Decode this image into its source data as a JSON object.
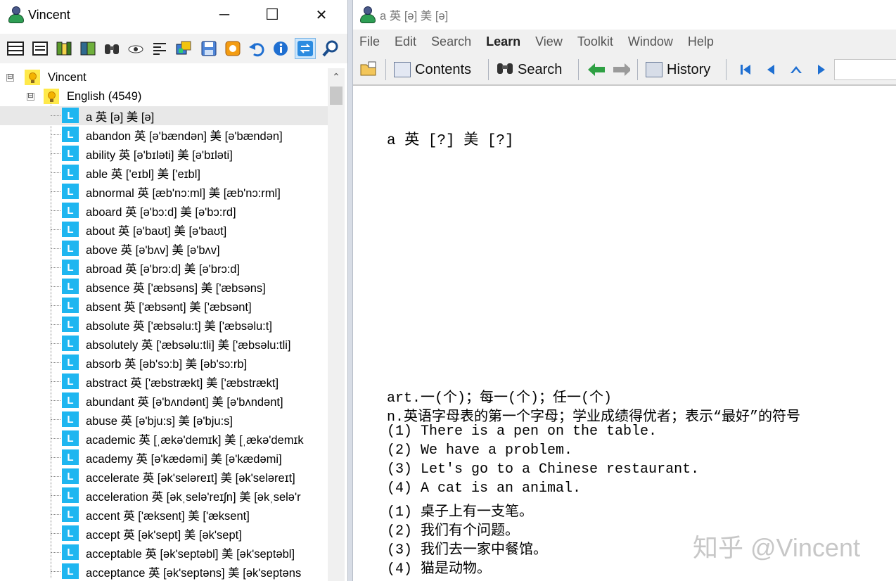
{
  "left_window": {
    "title": "Vincent",
    "controls": {
      "minimize": "─",
      "maximize": "☐",
      "close": "✕"
    }
  },
  "tree": {
    "root": {
      "label": "Vincent",
      "expander": "⊟"
    },
    "group": {
      "label": "English (4549)",
      "expander": "⊟"
    },
    "leaf_letter": "L",
    "items": [
      "a 英 [ə] 美 [ə]",
      "abandon 英 [ə'bændən] 美 [ə'bændən]",
      "ability 英 [ə'bɪləti] 美 [ə'bɪləti]",
      "able 英 ['eɪbl] 美 ['eɪbl]",
      "abnormal 英 [æb'nɔ:ml] 美 [æb'nɔ:rml]",
      "aboard 英 [ə'bɔ:d] 美 [ə'bɔ:rd]",
      "about 英 [ə'baʊt] 美 [ə'baʊt]",
      "above 英 [ə'bʌv] 美 [ə'bʌv]",
      "abroad 英 [ə'brɔ:d] 美 [ə'brɔ:d]",
      "absence 英 ['æbsəns] 美 ['æbsəns]",
      "absent 英 ['æbsənt] 美 ['æbsənt]",
      "absolute 英 ['æbsəlu:t] 美 ['æbsəlu:t]",
      "absolutely 英 ['æbsəlu:tli] 美 ['æbsəlu:tli]",
      "absorb 英 [əb'sɔ:b] 美 [əb'sɔ:rb]",
      "abstract 英 ['æbstrækt] 美 ['æbstrækt]",
      "abundant 英 [ə'bʌndənt] 美 [ə'bʌndənt]",
      "abuse 英 [ə'bju:s] 美 [ə'bju:s]",
      "academic 英 [ˌækə'demɪk] 美 [ˌækə'demɪk",
      "academy 英 [ə'kædəmi] 美 [ə'kædəmi]",
      "accelerate 英 [ək'seləreɪt] 美 [ək'seləreɪt]",
      "acceleration 英 [əkˌselə'reɪʃn] 美 [əkˌselə'r",
      "accent 英 ['æksent] 美 ['æksent]",
      "accept 英 [ək'sept] 美 [ək'sept]",
      "acceptable 英 [ək'septəbl] 美 [ək'septəbl]",
      "acceptance 英 [ək'septəns] 美 [ək'septəns"
    ]
  },
  "scrollbar": {
    "up_arrow": "⌃"
  },
  "right_window": {
    "title": "a 英 [ə] 美 [ə]",
    "menu": [
      "File",
      "Edit",
      "Search",
      "Learn",
      "View",
      "Toolkit",
      "Window",
      "Help"
    ],
    "toolbar": {
      "contents": "Contents",
      "search": "Search",
      "history": "History"
    }
  },
  "content": {
    "headword": "a 英 [?] 美 [?]",
    "lines": [
      "art.一(个)；每一(个)；任一(个)",
      "n.英语字母表的第一个字母；学业成绩得优者；表示“最好”的符号",
      "(1) There is a pen on the table.",
      "(2) We have a problem.",
      "(3) Let's go to a Chinese restaurant.",
      "(4) A cat is an animal.",
      "(1) 桌子上有一支笔。",
      "(2) 我们有个问题。",
      "(3) 我们去一家中餐馆。",
      "(4) 猫是动物。"
    ]
  },
  "watermark": "知乎 @Vincent",
  "colors": {
    "leaf_icon": "#1fb6f0",
    "bulb_bg": "#ffe94a",
    "nav_green": "#2ea043",
    "nav_blue": "#1f6fd1",
    "selected_row": "#e8e8e8"
  }
}
